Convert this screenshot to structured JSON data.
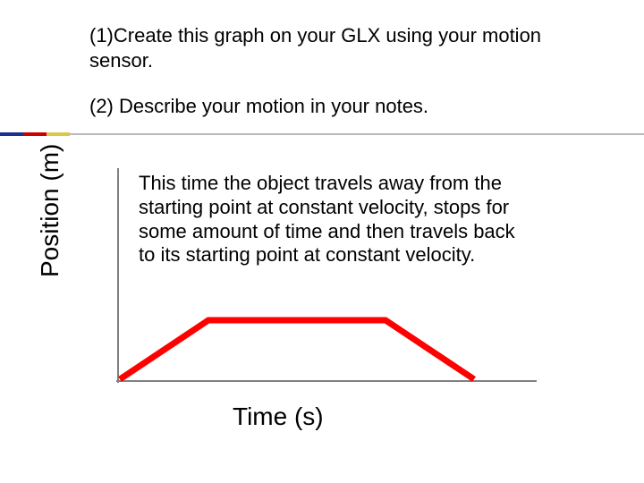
{
  "title_line1": "(1)Create this graph on your GLX using your motion sensor.",
  "title_line2": "(2) Describe your motion in your notes.",
  "ylabel": "Position (m)",
  "xlabel": "Time (s)",
  "description": "This time the object travels away from the starting point at constant velocity, stops for some amount of time and then travels back to its starting point at constant velocity.",
  "colors": {
    "accent_blue": "#1a2f8f",
    "accent_red": "#cc0000",
    "accent_yellow": "#d9c94a",
    "plot_red": "#ff0000",
    "axis_gray": "#808080"
  },
  "chart_data": {
    "type": "line",
    "title": "",
    "xlabel": "Time (s)",
    "ylabel": "Position (m)",
    "xlim": [
      0,
      10
    ],
    "ylim": [
      0,
      1
    ],
    "grid": false,
    "series": [
      {
        "name": "position",
        "x": [
          0,
          2.5,
          7.5,
          10
        ],
        "y": [
          0,
          1,
          1,
          0
        ]
      }
    ],
    "note": "Qualitative trapezoid position-vs-time: moves away at constant velocity, rests, returns at constant velocity. No numeric ticks shown; values normalized 0–1 / 0–10."
  }
}
